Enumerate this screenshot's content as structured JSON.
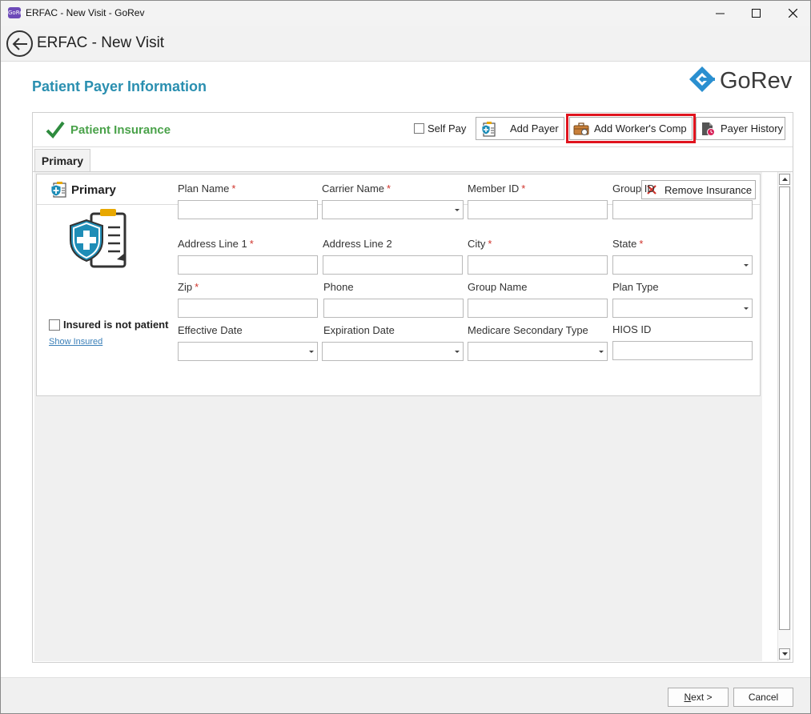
{
  "window": {
    "title": "ERFAC - New Visit - GoRev",
    "app_icon_text": "GoRev"
  },
  "header": {
    "title": "ERFAC - New Visit"
  },
  "page": {
    "title": "Patient Payer Information",
    "logo_text": "GoRev"
  },
  "insurance_panel": {
    "title": "Patient Insurance",
    "self_pay_label": "Self Pay",
    "self_pay_checked": false,
    "buttons": {
      "add_payer": "Add Payer",
      "add_workers_comp": "Add Worker's Comp",
      "payer_history": "Payer History"
    },
    "tabs": [
      {
        "label": "Primary",
        "active": true
      }
    ]
  },
  "primary_card": {
    "title": "Primary",
    "remove_label": "Remove Insurance",
    "insured_not_patient_label": "Insured is not patient",
    "insured_not_patient_checked": false,
    "show_insured_link": "Show Insured",
    "fields": {
      "plan_name": {
        "label": "Plan Name",
        "required": "*",
        "value": ""
      },
      "carrier_name": {
        "label": "Carrier Name",
        "required": "*",
        "value": ""
      },
      "member_id": {
        "label": "Member ID",
        "required": "*",
        "value": ""
      },
      "group_id": {
        "label": "Group ID",
        "value": ""
      },
      "address_line_1": {
        "label": "Address Line 1",
        "required": "*",
        "value": ""
      },
      "address_line_2": {
        "label": "Address Line 2",
        "value": ""
      },
      "city": {
        "label": "City",
        "required": "*",
        "value": ""
      },
      "state": {
        "label": "State",
        "required": "*",
        "value": ""
      },
      "zip": {
        "label": "Zip",
        "required": "*",
        "value": ""
      },
      "phone": {
        "label": "Phone",
        "value": ""
      },
      "group_name": {
        "label": "Group Name",
        "value": ""
      },
      "plan_type": {
        "label": "Plan Type",
        "value": ""
      },
      "effective_date": {
        "label": "Effective Date",
        "value": ""
      },
      "expiration_date": {
        "label": "Expiration Date",
        "value": ""
      },
      "medicare_secondary_type": {
        "label": "Medicare Secondary Type",
        "value": ""
      },
      "hios_id": {
        "label": "HIOS ID",
        "value": ""
      }
    }
  },
  "footer": {
    "next_label": "ext >",
    "next_mnemonic": "N",
    "cancel_label": "Cancel"
  },
  "colors": {
    "accent": "#2a8fb0",
    "success": "#4aa24a",
    "highlight": "#e0141e",
    "required": "#d0342c"
  }
}
